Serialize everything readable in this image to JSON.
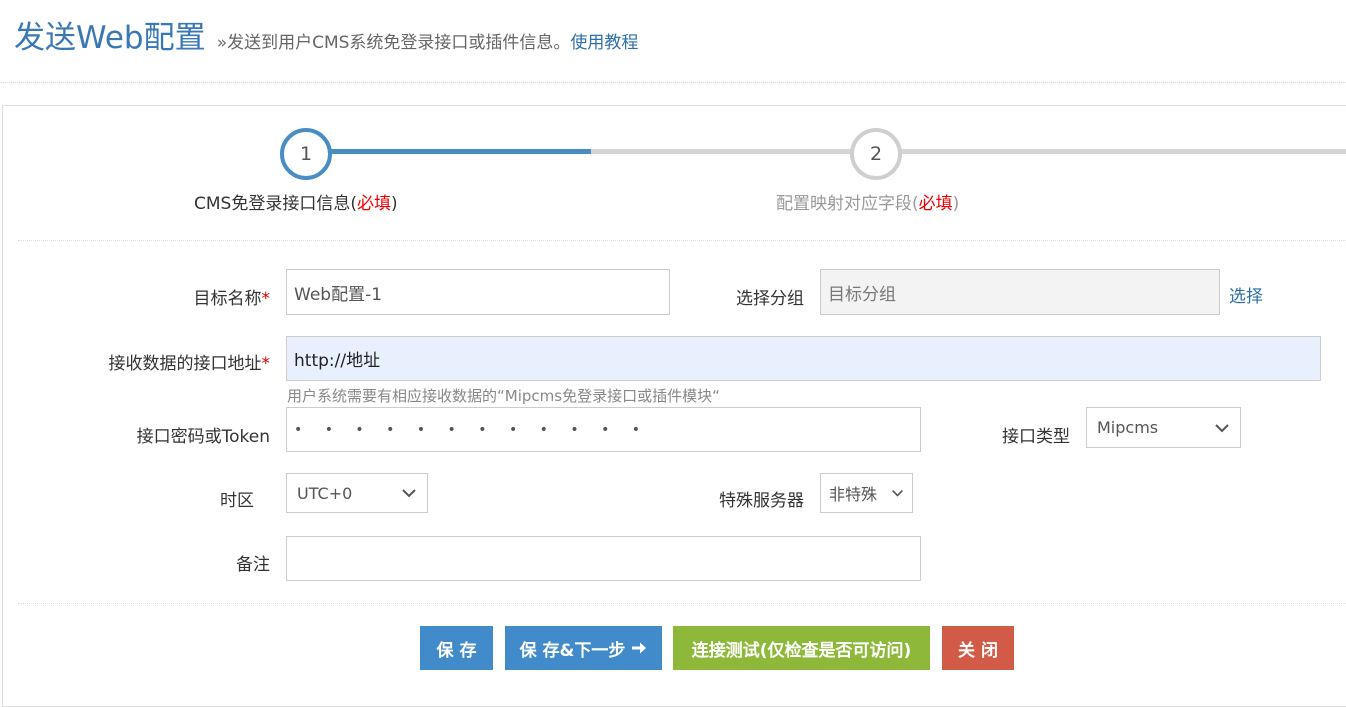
{
  "header": {
    "title": "发送Web配置",
    "subtitle": "»发送到用户CMS系统免登录接口或插件信息。",
    "tutorial_link": "使用教程"
  },
  "steps": [
    {
      "number": "1",
      "label": "CMS免登录接口信息(",
      "required": "必填",
      "label_end": ")"
    },
    {
      "number": "2",
      "label": "配置映射对应字段(",
      "required": "必填",
      "label_end": ")"
    }
  ],
  "form": {
    "target_name": {
      "label": "目标名称",
      "required_mark": "*",
      "value": "Web配置-1"
    },
    "group": {
      "label": "选择分组",
      "placeholder": "目标分组",
      "select_link": "选择"
    },
    "endpoint": {
      "label": "接收数据的接口地址",
      "required_mark": "*",
      "value": "http://地址",
      "hint": "用户系统需要有相应接收数据的“Mipcms免登录接口或插件模块“"
    },
    "token": {
      "label": "接口密码或Token",
      "value": "• • • • • • • • • • • •"
    },
    "interface_type": {
      "label": "接口类型",
      "selected": "Mipcms"
    },
    "timezone": {
      "label": "时区",
      "selected": "UTC+0"
    },
    "special_server": {
      "label": "特殊服务器",
      "selected": "非特殊"
    },
    "remark": {
      "label": "备注",
      "value": ""
    }
  },
  "buttons": {
    "save": "保 存",
    "save_next": "保 存&下一步",
    "test": "连接测试(仅检查是否可访问)",
    "close": "关 闭"
  },
  "colors": {
    "primary": "#428bca",
    "success": "#8db839",
    "danger": "#d15b47",
    "step_active": "#4a8cc4"
  }
}
